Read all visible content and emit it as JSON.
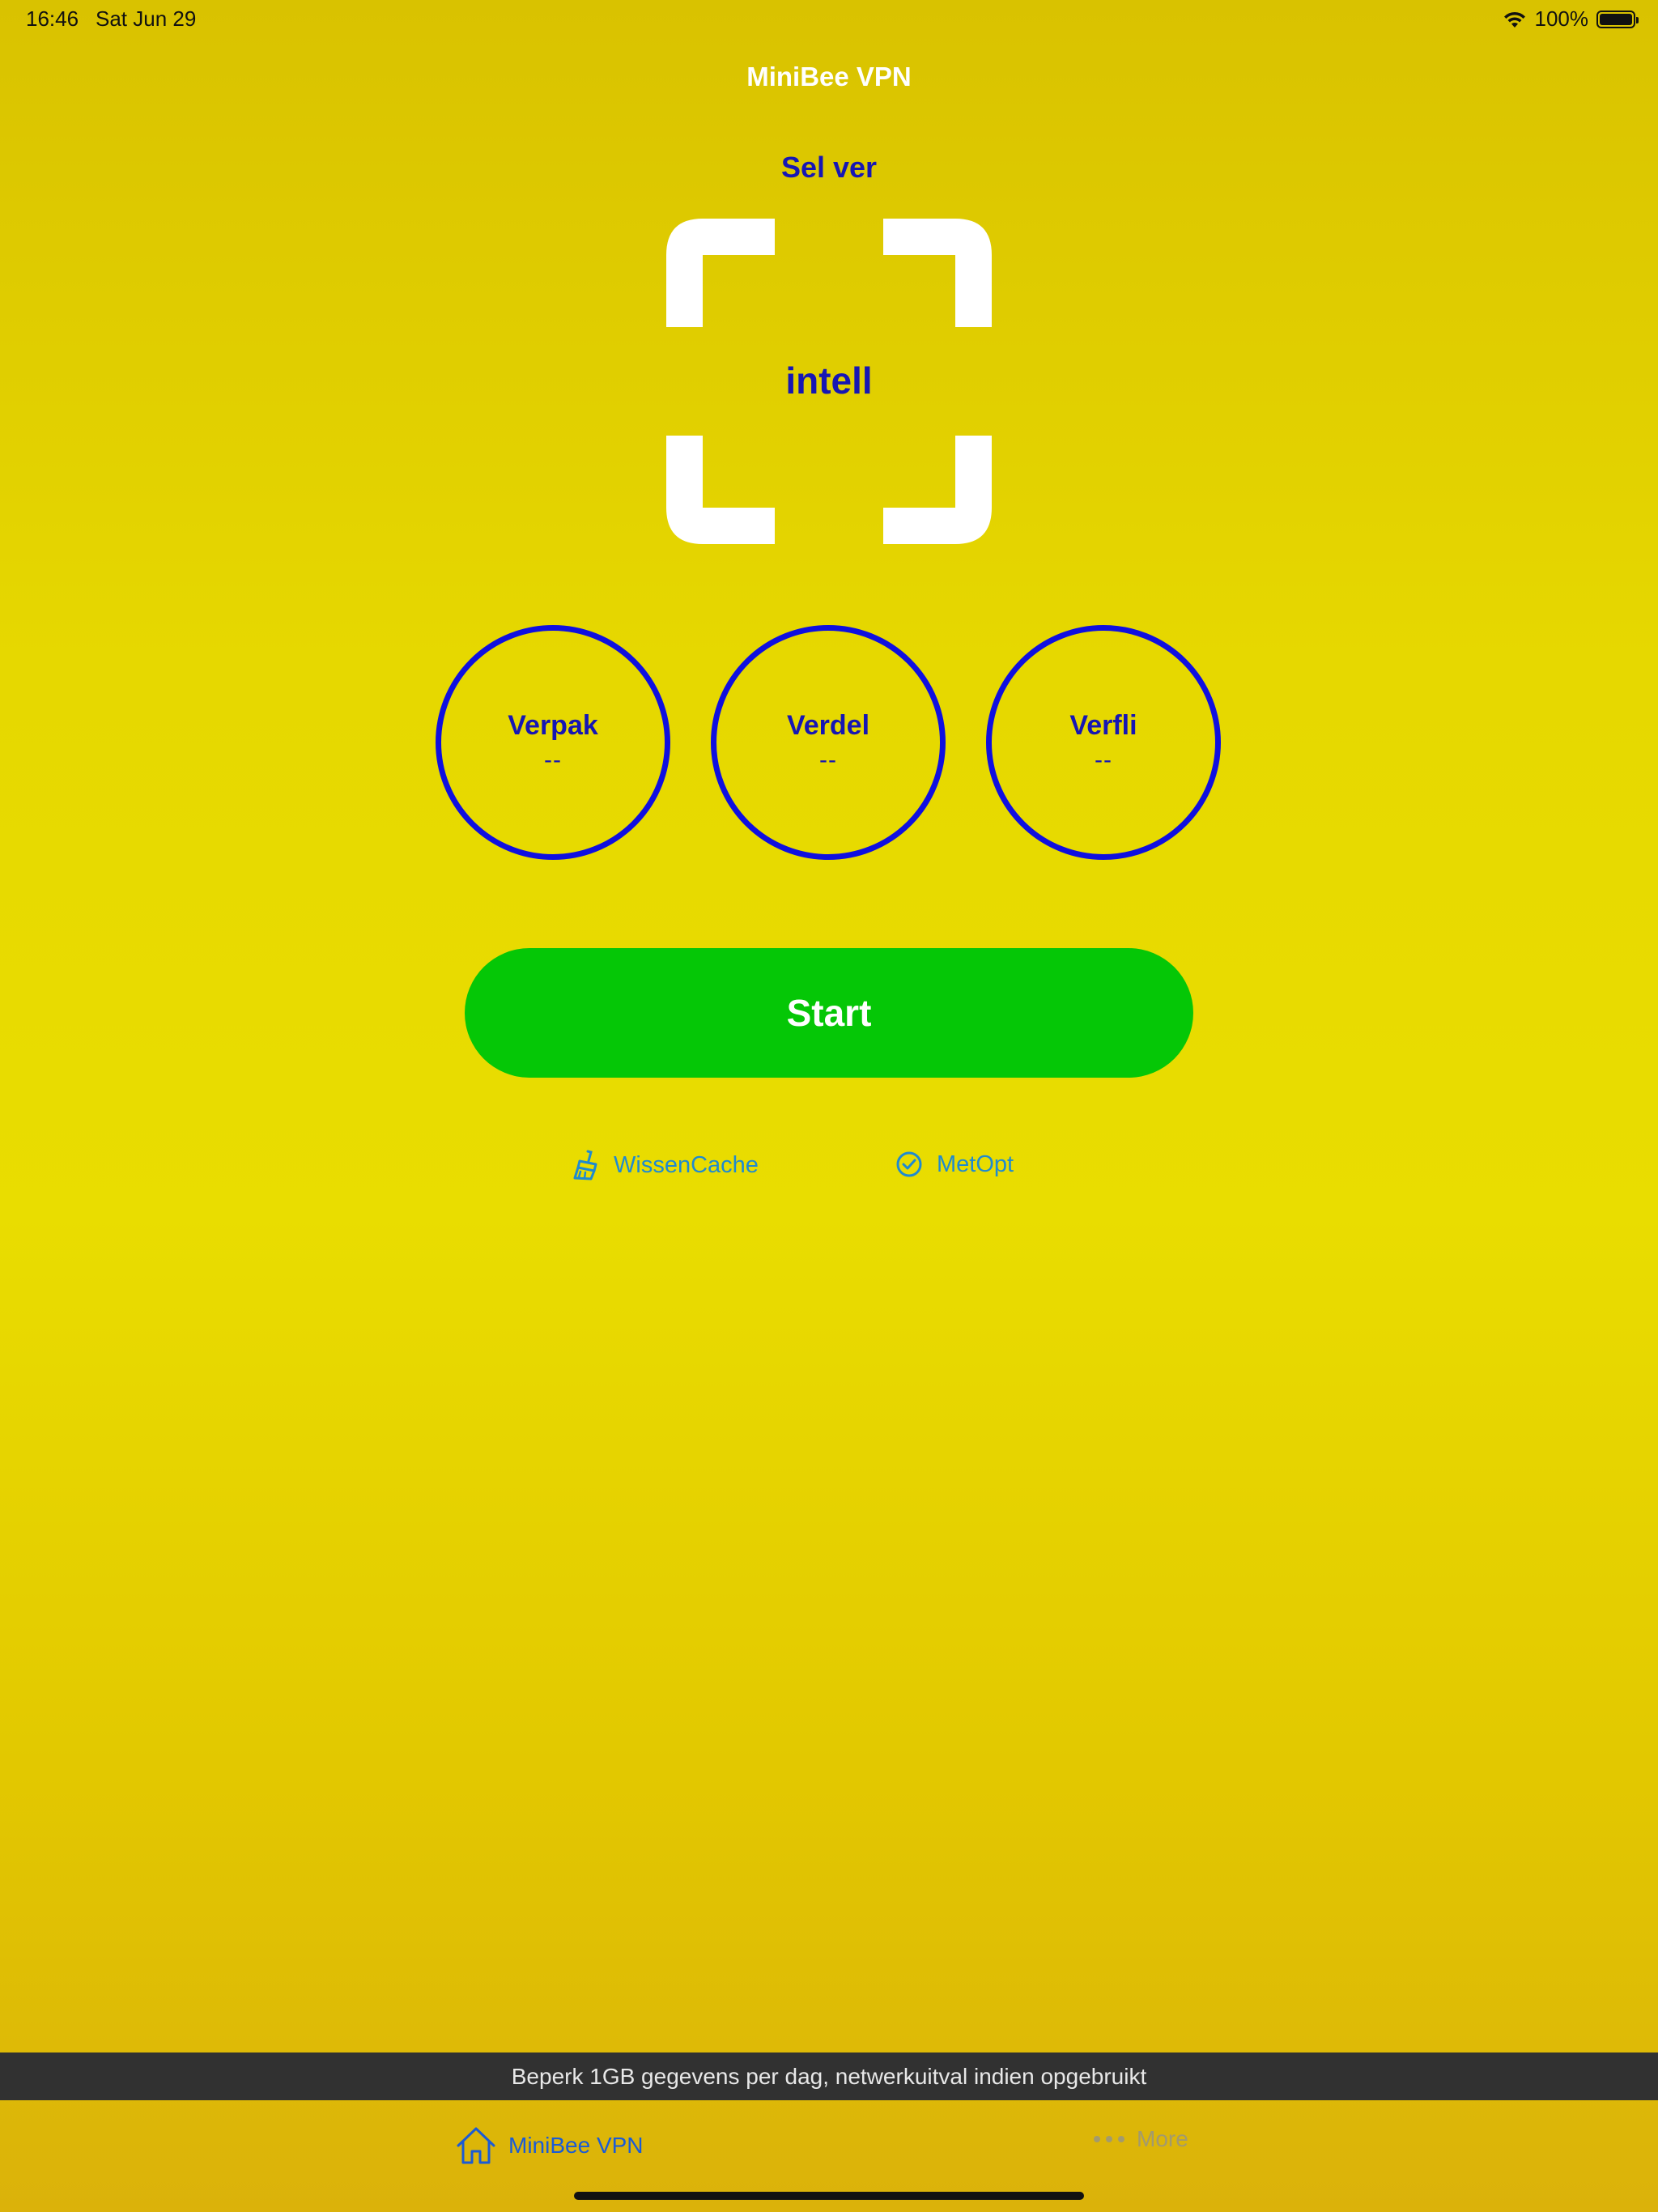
{
  "status_bar": {
    "time": "16:46",
    "date": "Sat Jun 29",
    "battery": "100%"
  },
  "nav": {
    "title": "MiniBee VPN"
  },
  "server": {
    "label": "Sel ver",
    "mode": "intell"
  },
  "stats": [
    {
      "label": "Verpak",
      "value": "--"
    },
    {
      "label": "Verdel",
      "value": "--"
    },
    {
      "label": "Verfli",
      "value": "--"
    }
  ],
  "start_button": {
    "label": "Start"
  },
  "actions": {
    "clear_cache": "WissenCache",
    "speed_test": "MetOpt"
  },
  "banner": {
    "text": "Beperk 1GB gegevens per dag, netwerkuitval indien opgebruikt"
  },
  "tabs": [
    {
      "label": "MiniBee VPN",
      "icon": "home-icon"
    },
    {
      "label": "More",
      "icon": "more-icon"
    }
  ],
  "colors": {
    "accent_blue": "#1616b4",
    "ring_blue": "#0f0fe0",
    "start_green": "#05c706",
    "link_blue": "#1f8ad0",
    "tab_active": "#1a5bd6",
    "tab_inactive": "#a29a6e",
    "banner_bg": "#313131"
  }
}
